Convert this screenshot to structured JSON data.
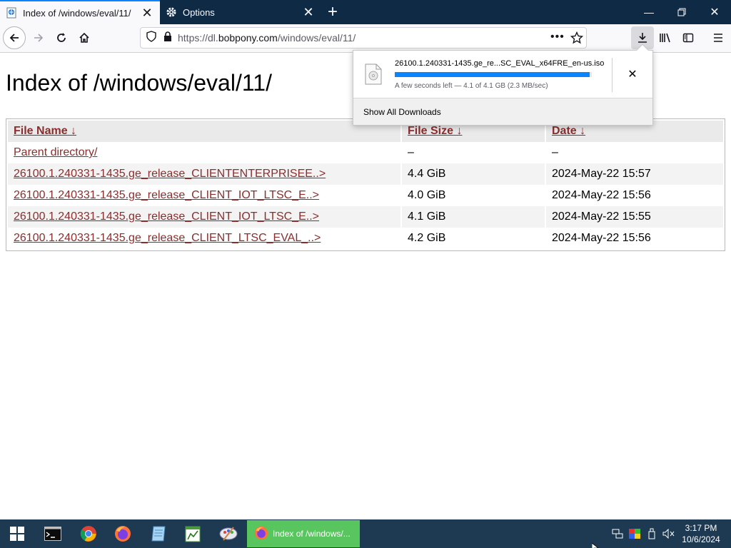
{
  "browser": {
    "tabs": [
      {
        "title": "Index of /windows/eval/11/",
        "active": true
      },
      {
        "title": "Options",
        "active": false
      }
    ],
    "url_prefix": "https://dl.",
    "url_domain": "bobpony.com",
    "url_path": "/windows/eval/11/"
  },
  "page": {
    "title": "Index of /windows/eval/11/",
    "columns": [
      "File Name ↓",
      "File Size ↓",
      "Date ↓"
    ],
    "rows": [
      {
        "name": "Parent directory/",
        "size": "–",
        "date": "–"
      },
      {
        "name": "26100.1.240331-1435.ge_release_CLIENTENTERPRISEE..>",
        "size": "4.4 GiB",
        "date": "2024-May-22 15:57"
      },
      {
        "name": "26100.1.240331-1435.ge_release_CLIENT_IOT_LTSC_E..>",
        "size": "4.0 GiB",
        "date": "2024-May-22 15:56"
      },
      {
        "name": "26100.1.240331-1435.ge_release_CLIENT_IOT_LTSC_E..>",
        "size": "4.1 GiB",
        "date": "2024-May-22 15:55"
      },
      {
        "name": "26100.1.240331-1435.ge_release_CLIENT_LTSC_EVAL_..>",
        "size": "4.2 GiB",
        "date": "2024-May-22 15:56"
      }
    ]
  },
  "downloads": {
    "filename": "26100.1.240331-1435.ge_re...SC_EVAL_x64FRE_en-us.iso",
    "status": "A few seconds left — 4.1 of 4.1 GB (2.3 MB/sec)",
    "progress": 0.99,
    "show_all": "Show All Downloads"
  },
  "taskbar": {
    "active_window": "Index of /windows/...",
    "time": "3:17 PM",
    "date": "10/6/2024"
  },
  "colors": {
    "accent": "#0a84ff",
    "link": "#8b2d2d",
    "taskbar": "#1e3a52",
    "tabbar": "#0f2a45"
  }
}
